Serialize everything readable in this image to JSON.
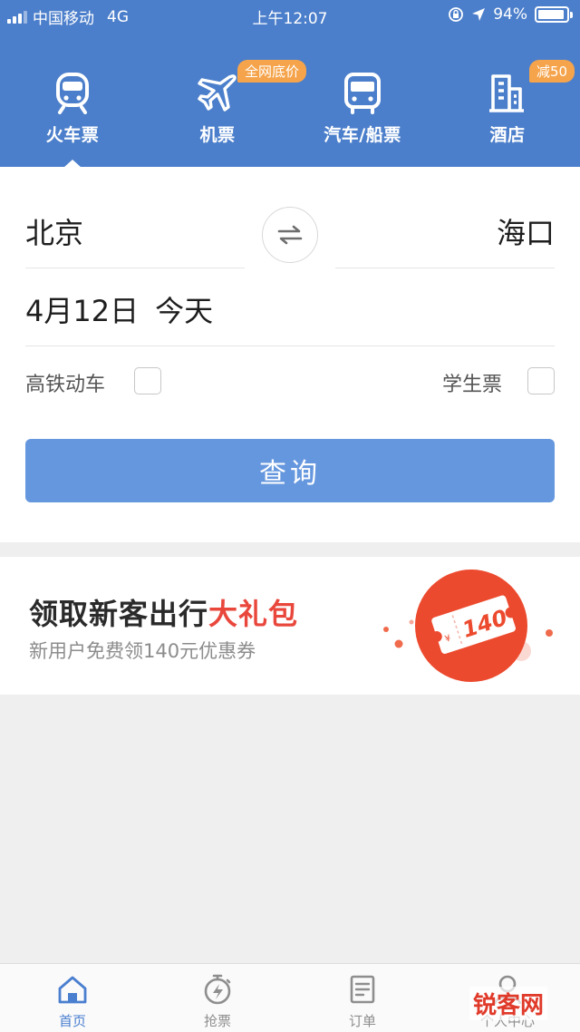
{
  "status_bar": {
    "carrier": "中国移动",
    "network": "4G",
    "time": "上午12:07",
    "battery": "94%",
    "battery_level": 0.94
  },
  "categories": [
    {
      "label": "火车票",
      "icon": "train-icon",
      "badge": ""
    },
    {
      "label": "机票",
      "icon": "airplane-icon",
      "badge": "全网底价"
    },
    {
      "label": "汽车/船票",
      "icon": "bus-icon",
      "badge": ""
    },
    {
      "label": "酒店",
      "icon": "hotel-icon",
      "badge": "减50"
    }
  ],
  "search": {
    "from_city": "北京",
    "to_city": "海口",
    "date": "4月12日",
    "date_note": "今天",
    "option_highspeed": "高铁动车",
    "option_student": "学生票",
    "submit_label": "查询"
  },
  "promo": {
    "title_main": "领取新客出行",
    "title_highlight": "大礼包",
    "subtitle": "新用户免费领140元优惠券",
    "coupon_value": "140",
    "coupon_currency": "¥"
  },
  "tabbar": [
    {
      "label": "首页",
      "icon": "home-icon"
    },
    {
      "label": "抢票",
      "icon": "stopwatch-icon"
    },
    {
      "label": "订单",
      "icon": "order-icon"
    },
    {
      "label": "个人中心",
      "icon": "profile-icon"
    }
  ],
  "watermark": "锐客网",
  "colors": {
    "header_blue": "#4c7fcb",
    "button_blue": "#6597de",
    "badge_orange": "#f5a44c",
    "promo_red": "#e9473c",
    "active_tab": "#4a7fd0"
  }
}
